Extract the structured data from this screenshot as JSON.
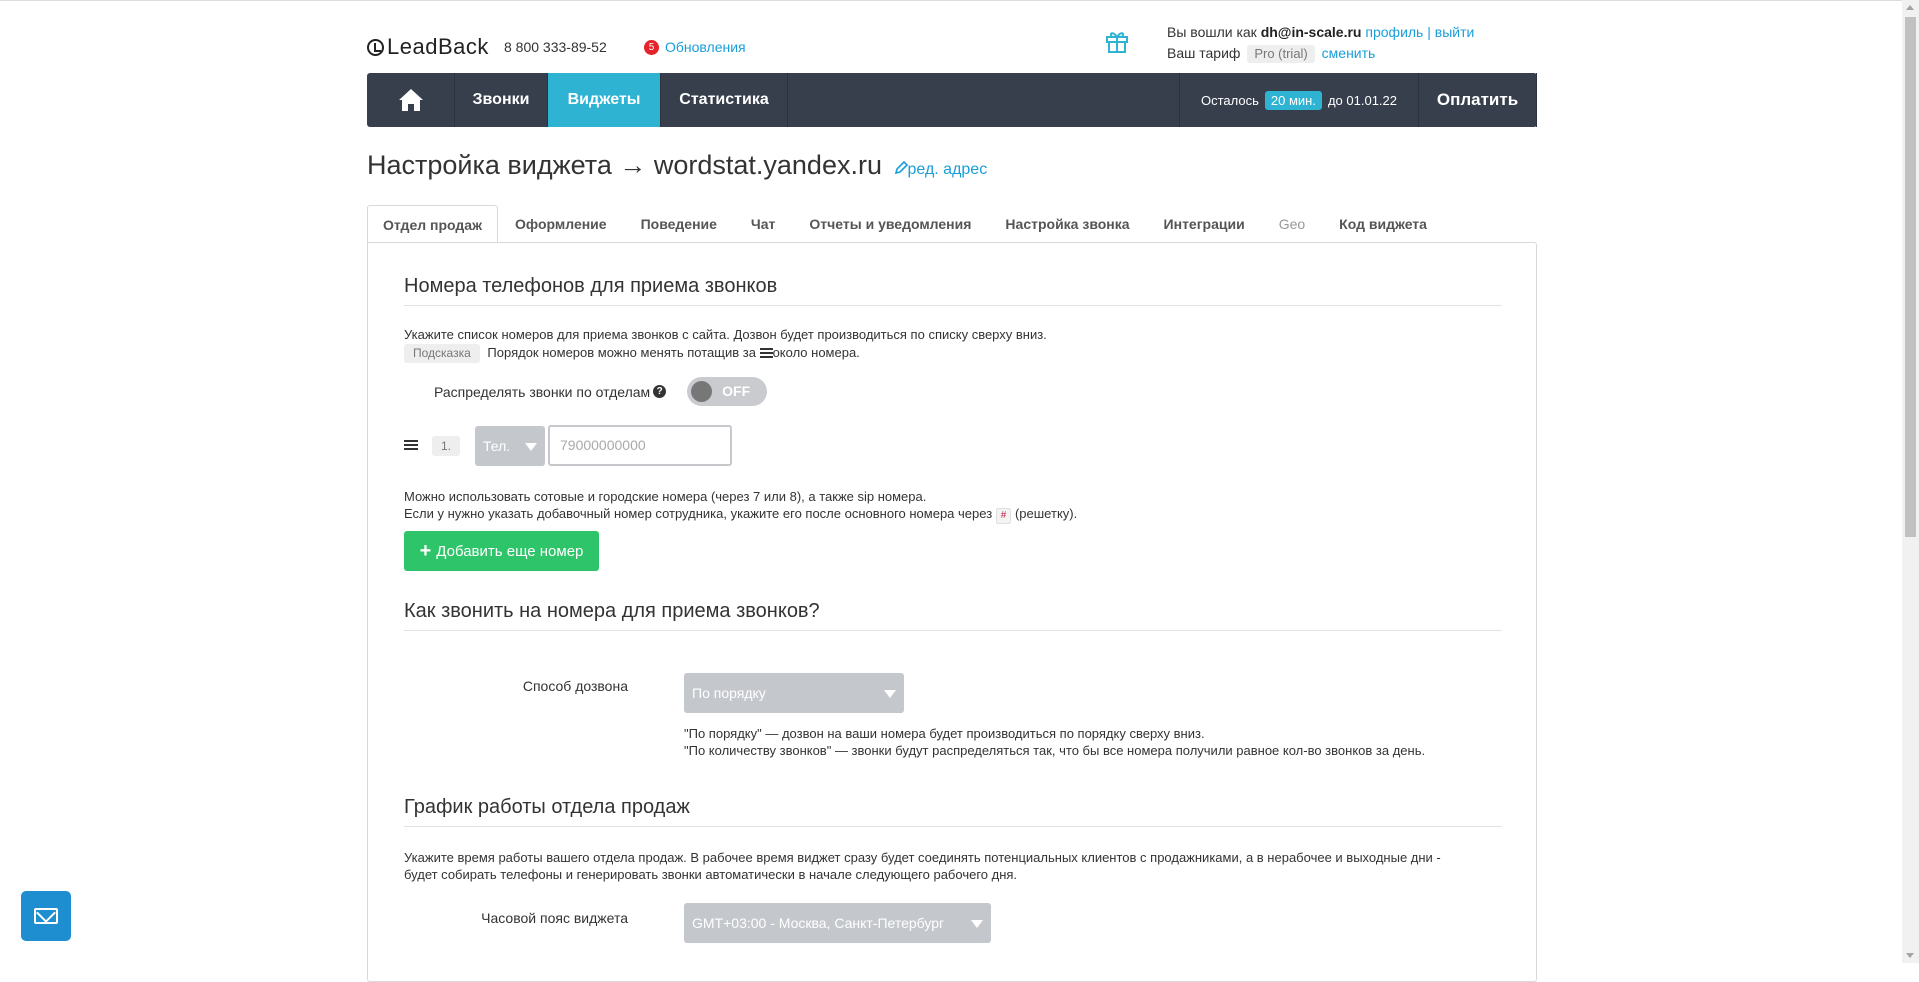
{
  "header": {
    "logo_text": "LeadBack",
    "phone": "8 800 333-89-52",
    "updates_count": "5",
    "updates_label": "Обновления",
    "logged_in_prefix": "Вы вошли как",
    "user_email": "dh@in-scale.ru",
    "profile_link": "профиль",
    "separator": "|",
    "logout_link": "выйти",
    "plan_prefix": "Ваш тариф",
    "plan_name": "Pro (trial)",
    "change_link": "сменить"
  },
  "nav": {
    "items": [
      {
        "label": "Звонки"
      },
      {
        "label": "Виджеты"
      },
      {
        "label": "Статистика"
      }
    ],
    "remain_prefix": "Осталось",
    "remain_value": "20 мин.",
    "remain_until": "до 01.01.22",
    "pay_label": "Оплатить"
  },
  "page": {
    "title": "Настройка виджета → wordstat.yandex.ru",
    "edit_link": "ред. адрес"
  },
  "tabs": [
    {
      "label": "Отдел продаж"
    },
    {
      "label": "Оформление"
    },
    {
      "label": "Поведение"
    },
    {
      "label": "Чат"
    },
    {
      "label": "Отчеты и уведомления"
    },
    {
      "label": "Настройка звонка"
    },
    {
      "label": "Интеграции"
    },
    {
      "label": "Geo"
    },
    {
      "label": "Код виджета"
    }
  ],
  "phones_section": {
    "title": "Номера телефонов для приема звонков",
    "desc": "Укажите список номеров для приема звонков с сайта. Дозвон будет производиться по списку сверху вниз.",
    "hint_badge": "Подсказка",
    "hint_text_before": "Порядок номеров можно менять потащив за",
    "hint_text_after": "около номера.",
    "distribute_label": "Распределять звонки по отделам",
    "help_icon": "?",
    "toggle_state": "OFF",
    "row_number": "1.",
    "type_select": "Тел.",
    "phone_placeholder": "79000000000",
    "note_line1": "Можно использовать сотовые и городские номера (через 7 или 8), а также sip номера.",
    "note_line2_before": "Если у нужно указать добавочный номер сотрудника, укажите его после основного номера через",
    "hash_symbol": "#",
    "note_line2_after": "(решетку).",
    "add_button": "Добавить еще номер"
  },
  "call_section": {
    "title": "Как звонить на номера для приема звонков?",
    "method_label": "Способ дозвона",
    "method_value": "По порядку",
    "note_line1": "\"По порядку\" — дозвон на ваши номера будет производиться по порядку сверху вниз.",
    "note_line2": "\"По количеству звонков\" — звонки будут распределяться так, что бы все номера получили равное кол-во звонков за день."
  },
  "schedule_section": {
    "title": "График работы отдела продаж",
    "desc_line1": "Укажите время работы вашего отдела продаж. В рабочее время виджет сразу будет соединять потенциальных клиентов с продажниками, а в нерабочее и выходные дни -",
    "desc_line2": "будет собирать телефоны и генерировать звонки автоматически в начале следующего рабочего дня.",
    "tz_label": "Часовой пояс виджета",
    "tz_value": "GMT+03:00 - Москва, Санкт-Петербург"
  },
  "colors": {
    "navbar": "#373f4d",
    "accent": "#2eb3d3",
    "link": "#1a9ed8",
    "add_button": "#2ec56a",
    "badge_red": "#e5232a"
  }
}
